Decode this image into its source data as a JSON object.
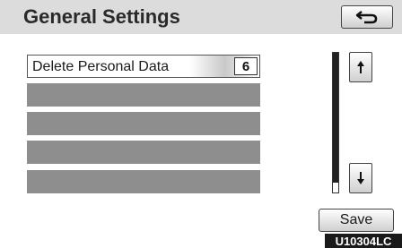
{
  "header": {
    "title": "General Settings",
    "back_icon": "return-arrow-icon"
  },
  "list": {
    "items": [
      {
        "label": "Delete Personal Data",
        "badge": "6"
      },
      {
        "label": ""
      },
      {
        "label": ""
      },
      {
        "label": ""
      },
      {
        "label": ""
      }
    ]
  },
  "scroll": {
    "up_icon": "scroll-up-arrow-icon",
    "down_icon": "scroll-down-arrow-icon"
  },
  "footer": {
    "save_label": "Save",
    "figure_code": "U10304LC"
  }
}
